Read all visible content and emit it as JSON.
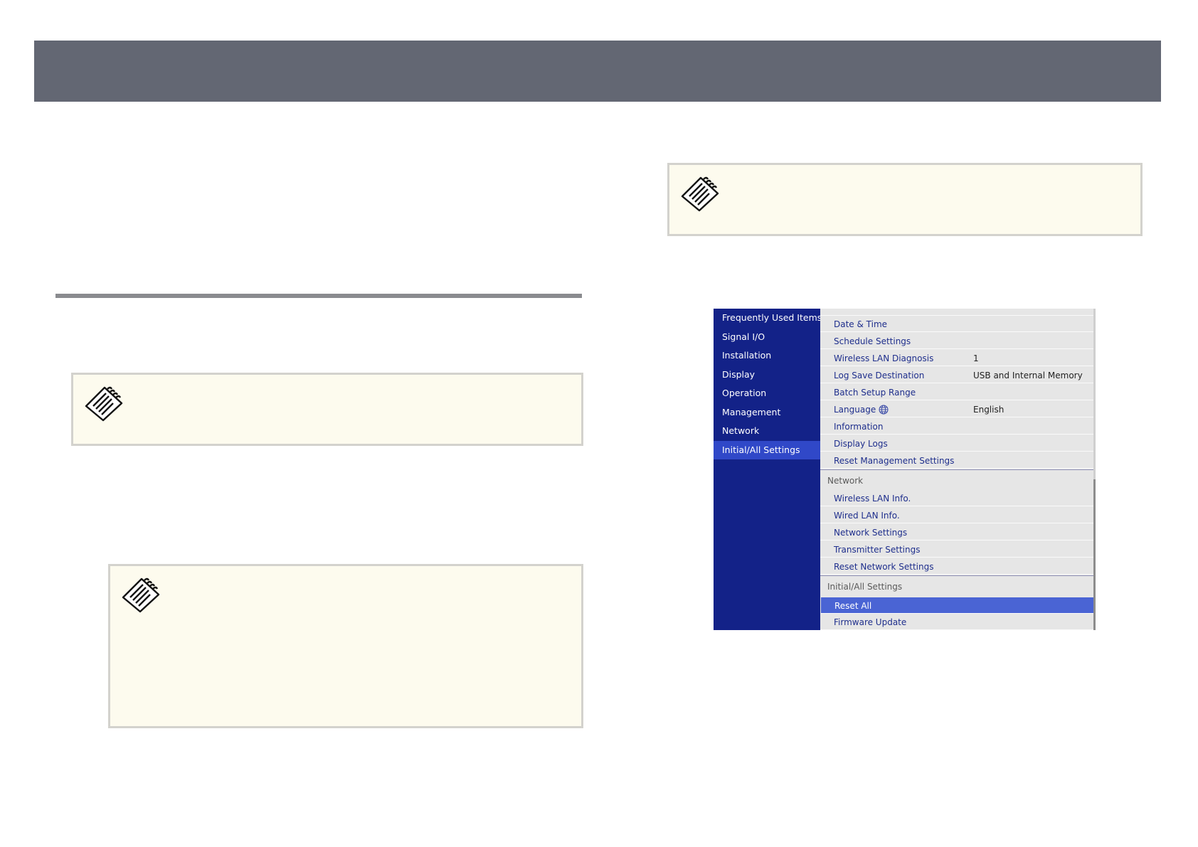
{
  "menu": {
    "sidebar": [
      {
        "label": "Frequently Used Items",
        "active": false
      },
      {
        "label": "Signal I/O",
        "active": false
      },
      {
        "label": "Installation",
        "active": false
      },
      {
        "label": "Display",
        "active": false
      },
      {
        "label": "Operation",
        "active": false
      },
      {
        "label": "Management",
        "active": false
      },
      {
        "label": "Network",
        "active": false
      },
      {
        "label": "Initial/All Settings",
        "active": true
      }
    ],
    "management_rows": [
      {
        "label": "Date & Time",
        "value": ""
      },
      {
        "label": "Schedule Settings",
        "value": ""
      },
      {
        "label": "Wireless LAN Diagnosis",
        "value": "1"
      },
      {
        "label": "Log Save Destination",
        "value": "USB and Internal Memory"
      },
      {
        "label": "Batch Setup Range",
        "value": ""
      },
      {
        "label": "Language",
        "value": "English"
      },
      {
        "label": "Information",
        "value": ""
      },
      {
        "label": "Display Logs",
        "value": ""
      },
      {
        "label": "Reset Management Settings",
        "value": ""
      }
    ],
    "network_group": {
      "label": "Network",
      "rows": [
        {
          "label": "Wireless LAN Info."
        },
        {
          "label": "Wired LAN Info."
        },
        {
          "label": "Network Settings"
        },
        {
          "label": "Transmitter Settings"
        },
        {
          "label": "Reset Network Settings"
        }
      ]
    },
    "initial_group": {
      "label": "Initial/All Settings",
      "rows": [
        {
          "label": "Reset All",
          "selected": true
        },
        {
          "label": "Firmware Update",
          "selected": false
        }
      ]
    },
    "icons": {
      "language": "globe-icon",
      "note": "notepad-icon"
    },
    "colors": {
      "sidebar": "#132288",
      "sidebar_active": "#3048c8",
      "row_selected": "#4a64d4",
      "panel": "#e6e6e6",
      "header_band": "#636773",
      "note_background": "#fdfbee"
    }
  }
}
